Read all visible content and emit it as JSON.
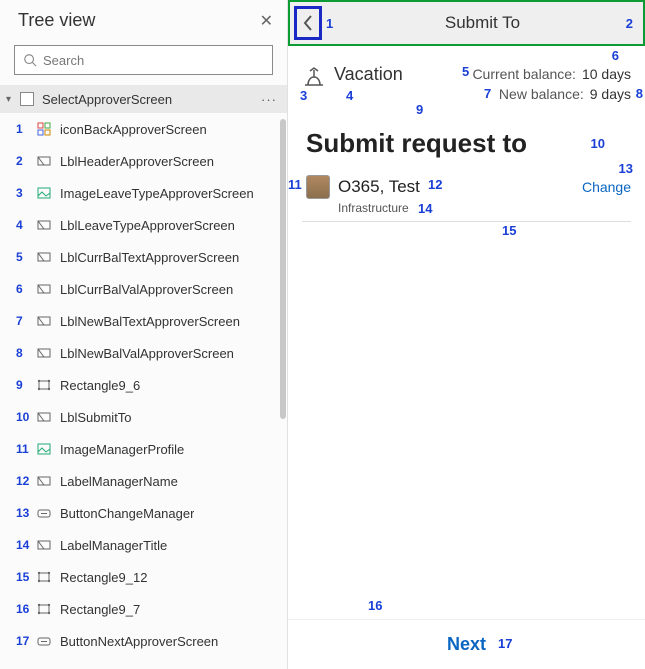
{
  "tree": {
    "title": "Tree view",
    "search_placeholder": "Search",
    "root": "SelectApproverScreen",
    "items": [
      {
        "n": "1",
        "name": "iconBackApproverScreen",
        "icon": "group"
      },
      {
        "n": "2",
        "name": "LblHeaderApproverScreen",
        "icon": "label"
      },
      {
        "n": "3",
        "name": "ImageLeaveTypeApproverScreen",
        "icon": "image"
      },
      {
        "n": "4",
        "name": "LblLeaveTypeApproverScreen",
        "icon": "label"
      },
      {
        "n": "5",
        "name": "LblCurrBalTextApproverScreen",
        "icon": "label"
      },
      {
        "n": "6",
        "name": "LblCurrBalValApproverScreen",
        "icon": "label"
      },
      {
        "n": "7",
        "name": "LblNewBalTextApproverScreen",
        "icon": "label"
      },
      {
        "n": "8",
        "name": "LblNewBalValApproverScreen",
        "icon": "label"
      },
      {
        "n": "9",
        "name": "Rectangle9_6",
        "icon": "rect"
      },
      {
        "n": "10",
        "name": "LblSubmitTo",
        "icon": "label"
      },
      {
        "n": "11",
        "name": "ImageManagerProfile",
        "icon": "image"
      },
      {
        "n": "12",
        "name": "LabelManagerName",
        "icon": "label"
      },
      {
        "n": "13",
        "name": "ButtonChangeManager",
        "icon": "button"
      },
      {
        "n": "14",
        "name": "LabelManagerTitle",
        "icon": "label"
      },
      {
        "n": "15",
        "name": "Rectangle9_12",
        "icon": "rect"
      },
      {
        "n": "16",
        "name": "Rectangle9_7",
        "icon": "rect"
      },
      {
        "n": "17",
        "name": "ButtonNextApproverScreen",
        "icon": "button"
      }
    ]
  },
  "app": {
    "header": "Submit To",
    "leave_type": "Vacation",
    "curr_bal_label": "Current balance:",
    "curr_bal_val": "10 days",
    "new_bal_label": "New balance:",
    "new_bal_val": "9 days",
    "submit_title": "Submit request to",
    "manager_name": "O365, Test",
    "manager_title": "Infrastructure",
    "change": "Change",
    "next": "Next"
  },
  "ann": {
    "h1": "1",
    "h2": "2",
    "a3": "3",
    "a4": "4",
    "a5": "5",
    "a6": "6",
    "a7": "7",
    "a8": "8",
    "a9": "9",
    "a10": "10",
    "a11": "11",
    "a12": "12",
    "a13": "13",
    "a14": "14",
    "a15": "15",
    "a16": "16",
    "a17": "17"
  }
}
